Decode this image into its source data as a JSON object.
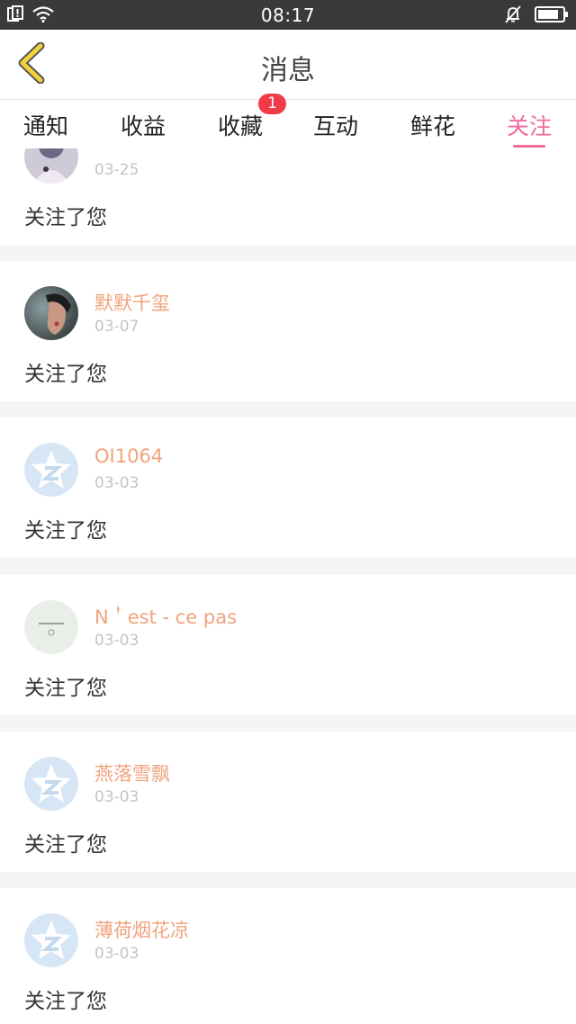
{
  "status_bar": {
    "time": "08:17"
  },
  "header": {
    "title": "消息"
  },
  "tabs": [
    {
      "label": "通知"
    },
    {
      "label": "收益"
    },
    {
      "label": "收藏",
      "badge": "1"
    },
    {
      "label": "互动"
    },
    {
      "label": "鲜花"
    },
    {
      "label": "关注",
      "active": true
    }
  ],
  "messages": [
    {
      "name": "",
      "date": "03-25",
      "text": "关注了您"
    },
    {
      "name": "默默千玺",
      "date": "03-07",
      "text": "关注了您"
    },
    {
      "name": "OI1064",
      "date": "03-03",
      "text": "关注了您"
    },
    {
      "name": "N＇est - ce pas",
      "date": "03-03",
      "text": "关注了您"
    },
    {
      "name": "燕落雪飘",
      "date": "03-03",
      "text": "关注了您"
    },
    {
      "name": "薄荷烟花凉",
      "date": "03-03",
      "text": "关注了您"
    }
  ],
  "colors": {
    "accent": "#ee6b9d",
    "username": "#f0a37c",
    "badge": "#f23b4a",
    "back_icon": "#f2d23a"
  }
}
